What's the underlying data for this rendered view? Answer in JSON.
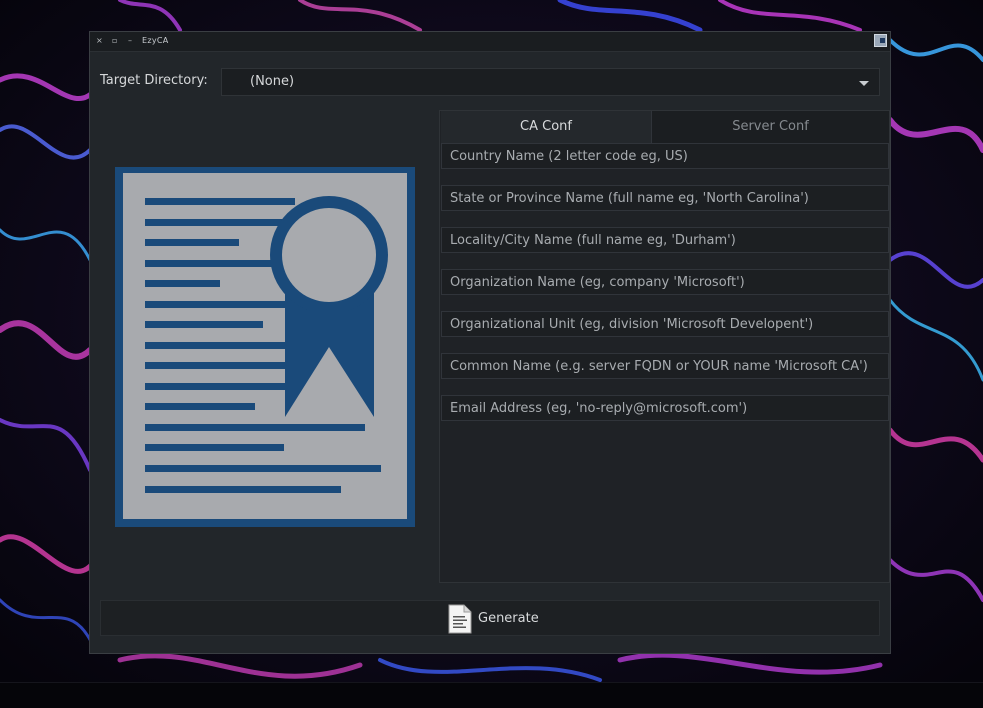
{
  "window": {
    "title": "EzyCA",
    "buttons": {
      "close": "×",
      "maximize": "▫",
      "minimize": "–"
    }
  },
  "target": {
    "label": "Target Directory:",
    "value": "(None)"
  },
  "tabs": [
    {
      "label": "CA Conf",
      "active": true
    },
    {
      "label": "Server Conf",
      "active": false
    }
  ],
  "fields": [
    {
      "placeholder": "Country Name (2 letter code eg, US)",
      "value": ""
    },
    {
      "placeholder": "State or Province Name (full name eg, 'North Carolina')",
      "value": ""
    },
    {
      "placeholder": "Locality/City Name (full name eg, 'Durham')",
      "value": ""
    },
    {
      "placeholder": "Organization Name (eg, company 'Microsoft')",
      "value": ""
    },
    {
      "placeholder": "Organizational Unit (eg, division 'Microsoft Developent')",
      "value": ""
    },
    {
      "placeholder": "Common Name (e.g. server FQDN or YOUR name 'Microsoft CA')",
      "value": ""
    },
    {
      "placeholder": "Email Address (eg, 'no-reply@microsoft.com')",
      "value": ""
    }
  ],
  "generate": {
    "label": "Generate"
  },
  "icons": {
    "certificate": "certificate-icon",
    "document": "document-icon",
    "dropdown": "chevron-down-icon"
  },
  "colors": {
    "cert_blue": "#1a4a7a",
    "cert_paper": "#a8aaae",
    "window_bg": "#22262a"
  }
}
